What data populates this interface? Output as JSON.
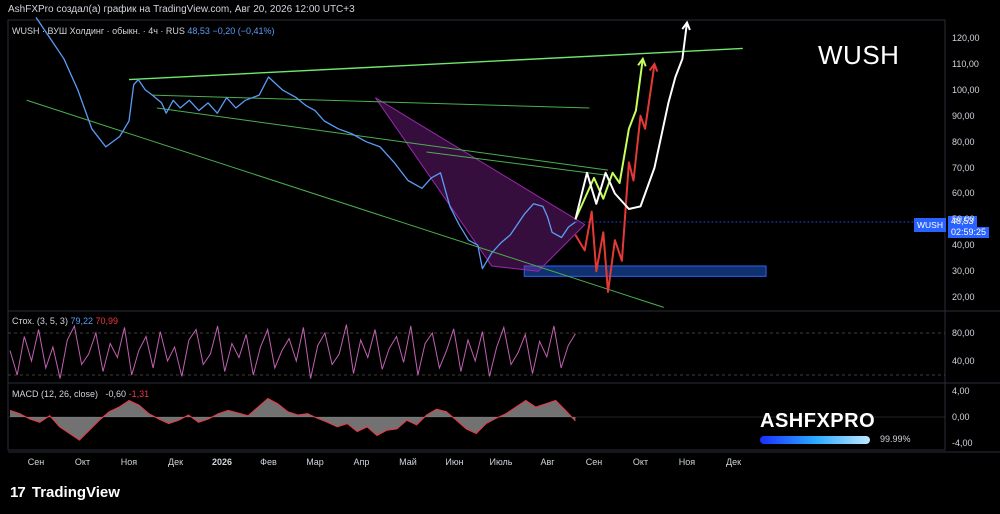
{
  "header": "AshFXPro создал(а) график на TradingView.com, Авг 20, 2026 12:00 UTC+3",
  "legend_main": {
    "symbol_desc": "WUSH · ВУШ Холдинг · обыкн. · 4ч · RUS",
    "last": "48,53",
    "change": "−0,20 (−0,41%)"
  },
  "watermark": "WUSH",
  "price_tag": {
    "symbol": "WUSH",
    "value": "48,53",
    "countdown": "02:59:25"
  },
  "stoch_legend": {
    "name": "Стох. (3, 5, 3)",
    "k": "79,22",
    "d": "70,99"
  },
  "macd_legend": {
    "name": "MACD (12, 26, close)",
    "v1": "-0,60",
    "v2": "-1,31"
  },
  "branding": {
    "name": "ASHFXPRO",
    "percent": "99.99%",
    "tv": "TradingView",
    "tv_icon": "17"
  },
  "colors": {
    "price": "#5b9cf6",
    "trend": "#4caf50",
    "wedge": "#9c27b0",
    "zone": "#1e4d8c",
    "stoch": "#c060b0",
    "macd_area": "#9e9e9e",
    "macd_line": "#f23645",
    "arrow_green": "#c6ff5a",
    "arrow_red": "#e53935",
    "arrow_white": "#ffffff"
  },
  "chart_data": [
    {
      "type": "line",
      "title": "WUSH · ВУШ Холдинг · обыкн. · 4ч · RUS",
      "x_ticks": [
        "Сен",
        "Окт",
        "Ноя",
        "Дек",
        "2026",
        "Фев",
        "Мар",
        "Апр",
        "Май",
        "Июн",
        "Июль",
        "Авг",
        "Сен",
        "Окт",
        "Ноя",
        "Дек"
      ],
      "y_ticks": [
        "120,00",
        "110,00",
        "100,00",
        "90,00",
        "80,00",
        "70,00",
        "60,00",
        "50,00",
        "40,00",
        "30,00",
        "20,00"
      ],
      "ylim": [
        15,
        127
      ],
      "x": [
        0,
        0.3,
        0.6,
        0.9,
        1.2,
        1.5,
        1.8,
        2.0,
        2.1,
        2.2,
        2.35,
        2.5,
        2.7,
        2.8,
        2.95,
        3.1,
        3.3,
        3.5,
        3.7,
        3.9,
        4.1,
        4.3,
        4.5,
        4.8,
        5.0,
        5.3,
        5.6,
        5.8,
        6.0,
        6.2,
        6.5,
        6.8,
        7.1,
        7.4,
        7.7,
        8.0,
        8.3,
        8.5,
        8.7,
        8.9,
        9.1,
        9.3,
        9.5,
        9.6,
        9.8,
        10.0,
        10.2,
        10.5,
        10.7,
        10.9,
        11.0,
        11.1,
        11.3,
        11.45,
        11.6
      ],
      "y": [
        128,
        120,
        112,
        100,
        85,
        78,
        82,
        88,
        102,
        104,
        100,
        98,
        95,
        91,
        96,
        93,
        96,
        92,
        95,
        91,
        97,
        93,
        96,
        98,
        105,
        100,
        97,
        94,
        92,
        88,
        85,
        83,
        80,
        78,
        72,
        65,
        62,
        66,
        68,
        55,
        48,
        42,
        40,
        31,
        37,
        41,
        44,
        52,
        56,
        55,
        51,
        45,
        43,
        47,
        49
      ],
      "trendlines": [
        {
          "from": [
            2.0,
            104
          ],
          "to": [
            15.2,
            116
          ]
        },
        {
          "from": [
            -0.2,
            96
          ],
          "to": [
            13.5,
            16
          ]
        },
        {
          "from": [
            2.5,
            98
          ],
          "to": [
            11.9,
            93
          ]
        },
        {
          "from": [
            2.6,
            93
          ],
          "to": [
            12.3,
            69
          ]
        },
        {
          "from": [
            8.4,
            76
          ],
          "to": [
            12.3,
            67
          ]
        }
      ],
      "wedge": [
        [
          7.3,
          97
        ],
        [
          11.8,
          48
        ],
        [
          10.8,
          30
        ],
        [
          9.8,
          32
        ]
      ],
      "zone": {
        "x": [
          10.5,
          15.7
        ],
        "y": [
          28,
          32
        ]
      },
      "projections": {
        "green": [
          [
            11.6,
            50
          ],
          [
            12.0,
            66
          ],
          [
            12.2,
            58
          ],
          [
            12.4,
            68
          ],
          [
            12.55,
            64
          ],
          [
            12.75,
            85
          ],
          [
            12.9,
            92
          ],
          [
            13.05,
            112
          ]
        ],
        "red": [
          [
            11.6,
            44
          ],
          [
            11.8,
            38
          ],
          [
            11.95,
            53
          ],
          [
            12.05,
            30
          ],
          [
            12.2,
            45
          ],
          [
            12.3,
            22
          ],
          [
            12.45,
            42
          ],
          [
            12.6,
            34
          ],
          [
            12.75,
            72
          ],
          [
            12.85,
            65
          ],
          [
            13.0,
            90
          ],
          [
            13.1,
            85
          ],
          [
            13.3,
            110
          ]
        ],
        "white": [
          [
            11.6,
            50
          ],
          [
            11.85,
            68
          ],
          [
            12.05,
            56
          ],
          [
            12.25,
            68
          ],
          [
            12.45,
            60
          ],
          [
            12.75,
            54
          ],
          [
            13.0,
            55
          ],
          [
            13.3,
            70
          ],
          [
            13.6,
            95
          ],
          [
            13.75,
            105
          ],
          [
            13.9,
            112
          ],
          [
            14.0,
            126
          ]
        ]
      }
    },
    {
      "type": "line",
      "title": "Стох. (3, 5, 3)",
      "y_ticks": [
        "80,00",
        "40,00"
      ],
      "ylim": [
        10,
        110
      ],
      "bands": [
        20,
        80
      ],
      "series": [
        {
          "name": "Стох. (3, 5, 3)",
          "values": [
            55,
            20,
            75,
            40,
            85,
            30,
            60,
            15,
            70,
            90,
            35,
            50,
            80,
            25,
            65,
            45,
            88,
            20,
            55,
            75,
            30,
            82,
            40,
            60,
            18,
            70,
            85,
            35,
            50,
            90,
            25,
            65,
            45,
            78,
            20,
            60,
            85,
            30,
            55,
            72,
            40,
            88,
            15,
            62,
            80,
            35,
            50,
            92,
            22,
            70,
            45,
            85,
            28,
            58,
            75,
            38,
            90,
            20,
            65,
            80,
            30,
            55,
            86,
            25,
            70,
            40,
            82,
            18,
            60,
            88,
            35,
            52,
            78,
            22,
            68,
            46,
            90,
            30,
            62,
            79
          ]
        }
      ]
    },
    {
      "type": "area",
      "title": "MACD (12, 26, close)",
      "y_ticks": [
        "4,00",
        "0,00",
        "-4,00"
      ],
      "ylim": [
        -5,
        5
      ],
      "series": [
        {
          "name": "MACD (12, 26, close)",
          "values": [
            1.0,
            0.5,
            -0.3,
            -0.8,
            0.2,
            -1.5,
            -2.5,
            -3.5,
            -2.0,
            -0.5,
            0.8,
            1.5,
            2.5,
            1.8,
            0.5,
            -0.3,
            -1.0,
            -0.5,
            0.3,
            -0.8,
            -0.3,
            0.5,
            1.0,
            0.6,
            0.2,
            1.5,
            2.8,
            2.0,
            0.8,
            0.3,
            0.5,
            -0.2,
            -0.8,
            -1.5,
            -1.0,
            -2.2,
            -1.5,
            -2.8,
            -2.0,
            -1.8,
            -0.5,
            -1.2,
            0.3,
            1.2,
            0.8,
            -0.5,
            -1.8,
            -2.5,
            -1.0,
            -0.2,
            0.5,
            1.5,
            2.5,
            1.5,
            2.0,
            2.5,
            1.0,
            -0.6
          ]
        }
      ]
    }
  ]
}
